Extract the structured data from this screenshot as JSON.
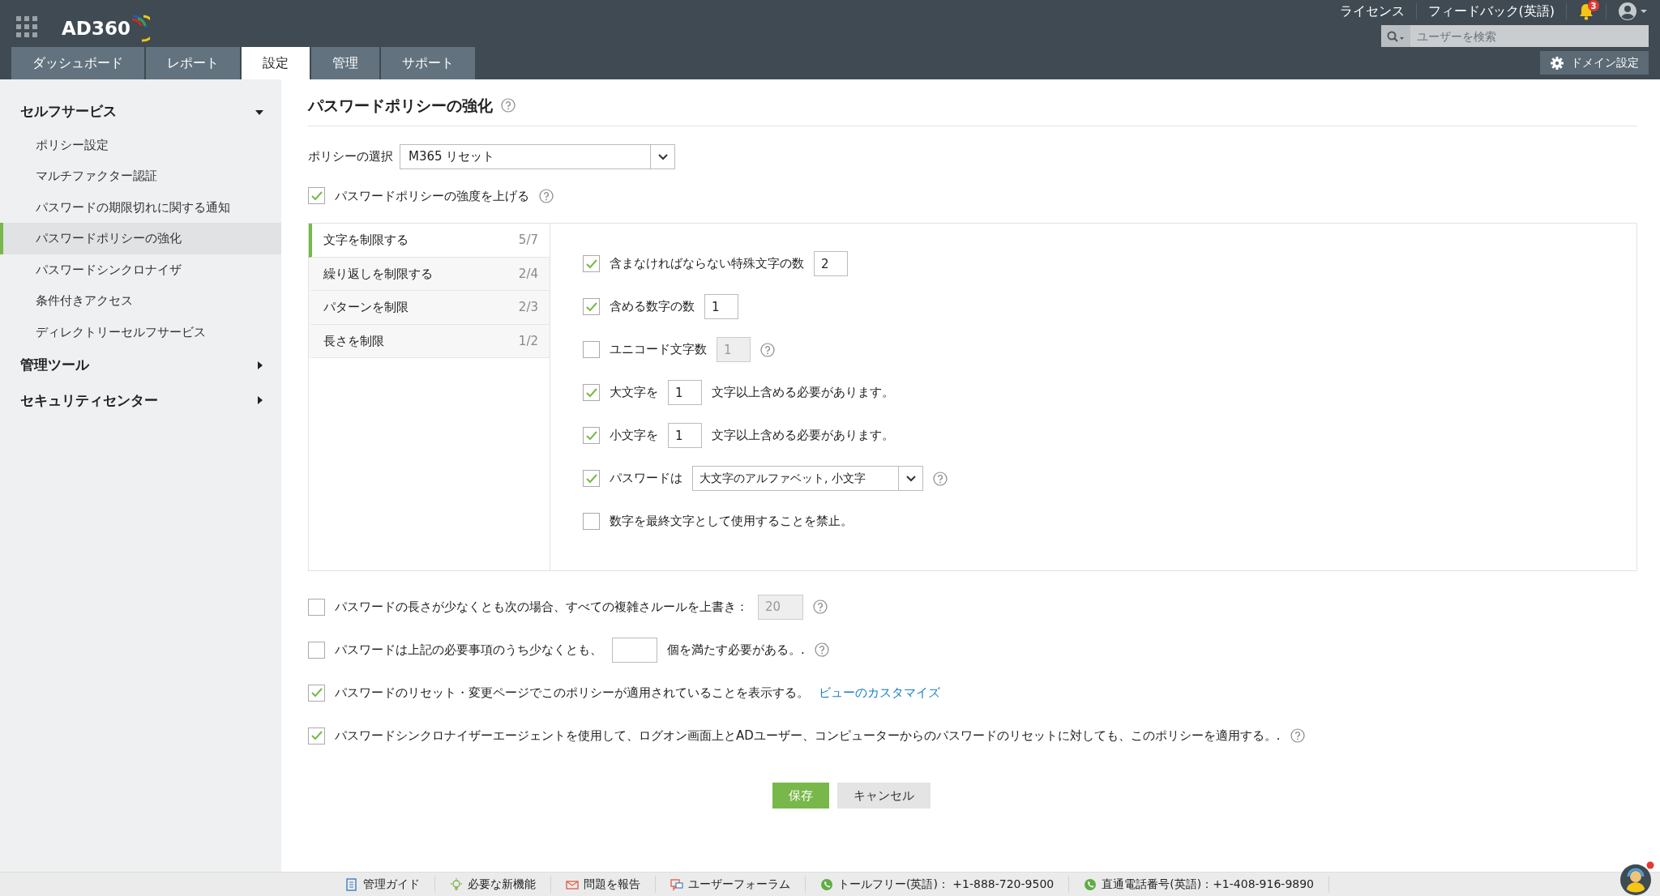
{
  "header": {
    "logo": "AD360",
    "tabs": [
      {
        "label": "ダッシュボード",
        "selected": false
      },
      {
        "label": "レポート",
        "selected": false
      },
      {
        "label": "設定",
        "selected": true
      },
      {
        "label": "管理",
        "selected": false
      },
      {
        "label": "サポート",
        "selected": false
      }
    ],
    "links": [
      "ライセンス",
      "フィードバック(英語)"
    ],
    "notification_count": "3",
    "search": {
      "placeholder": "ユーザーを検索"
    },
    "domain_button": "ドメイン設定"
  },
  "sidebar": {
    "sections": [
      {
        "label": "セルフサービス",
        "expanded": true,
        "children": [
          {
            "label": "ポリシー設定",
            "selected": false
          },
          {
            "label": "マルチファクター認証",
            "selected": false
          },
          {
            "label": "パスワードの期限切れに関する通知",
            "selected": false
          },
          {
            "label": "パスワードポリシーの強化",
            "selected": true
          },
          {
            "label": "パスワードシンクロナイザ",
            "selected": false
          },
          {
            "label": "条件付きアクセス",
            "selected": false
          },
          {
            "label": "ディレクトリーセルフサービス",
            "selected": false
          }
        ]
      },
      {
        "label": "管理ツール",
        "expanded": false
      },
      {
        "label": "セキュリティセンター",
        "expanded": false
      }
    ]
  },
  "page": {
    "title": "パスワードポリシーの強化",
    "policy_select": {
      "label": "ポリシーの選択",
      "value": "M365 リセット"
    },
    "enforce": {
      "label": "パスワードポリシーの強度を上げる",
      "checked": true
    },
    "rule_tabs": [
      {
        "label": "文字を制限する",
        "count": "5/7",
        "selected": true
      },
      {
        "label": "繰り返しを制限する",
        "count": "2/4",
        "selected": false
      },
      {
        "label": "パターンを制限",
        "count": "2/3",
        "selected": false
      },
      {
        "label": "長さを制限",
        "count": "1/2",
        "selected": false
      }
    ],
    "rules": [
      {
        "kind": "input",
        "checked": true,
        "label": "含まなければならない特殊文字の数",
        "value": "2",
        "disabled": false,
        "help": false
      },
      {
        "kind": "input",
        "checked": true,
        "label": "含める数字の数",
        "value": "1",
        "disabled": false,
        "help": false
      },
      {
        "kind": "input",
        "checked": false,
        "label": "ユニコード文字数",
        "value": "1",
        "disabled": true,
        "help": true
      },
      {
        "kind": "input",
        "checked": true,
        "label": "大文字を",
        "value": "1",
        "disabled": false,
        "after": "文字以上含める必要があります。",
        "help": false
      },
      {
        "kind": "input",
        "checked": true,
        "label": "小文字を",
        "value": "1",
        "disabled": false,
        "after": "文字以上含める必要があります。",
        "help": false
      },
      {
        "kind": "select",
        "checked": true,
        "label": "パスワードは",
        "value": "大文字のアルファベット, 小文字",
        "help": true
      },
      {
        "kind": "plain",
        "checked": false,
        "label": "数字を最終文字として使用することを禁止。",
        "help": false
      }
    ],
    "options": [
      {
        "kind": "input",
        "checked": false,
        "label": "パスワードの長さが少なくとも次の場合、すべての複雑さルールを上書き：",
        "value": "20",
        "disabled": true,
        "help": true
      },
      {
        "kind": "input",
        "checked": false,
        "label": "パスワードは上記の必要事項のうち少なくとも、",
        "disabled": false,
        "after": "個を満たす必要がある。.",
        "help": true
      },
      {
        "kind": "link",
        "checked": true,
        "label": "パスワードのリセット・変更ページでこのポリシーが適用されていることを表示する。",
        "link": "ビューのカスタマイズ",
        "help": false
      },
      {
        "kind": "plain",
        "checked": true,
        "label": "パスワードシンクロナイザーエージェントを使用して、ログオン画面上とADユーザー、コンピューターからのパスワードのリセットに対しても、このポリシーを適用する。.",
        "help": true
      }
    ],
    "buttons": {
      "save": "保存",
      "cancel": "キャンセル"
    }
  },
  "footer": {
    "items": [
      {
        "kind": "guide",
        "label": "管理ガイド"
      },
      {
        "kind": "bulb",
        "label": "必要な新機能"
      },
      {
        "kind": "mail",
        "label": "問題を報告"
      },
      {
        "kind": "forum",
        "label": "ユーザーフォーラム"
      },
      {
        "kind": "phone",
        "label": "トールフリー(英語)： +1-888-720-9500"
      },
      {
        "kind": "phone",
        "label": "直通電話番号(英語)：+1-408-916-9890"
      }
    ]
  }
}
